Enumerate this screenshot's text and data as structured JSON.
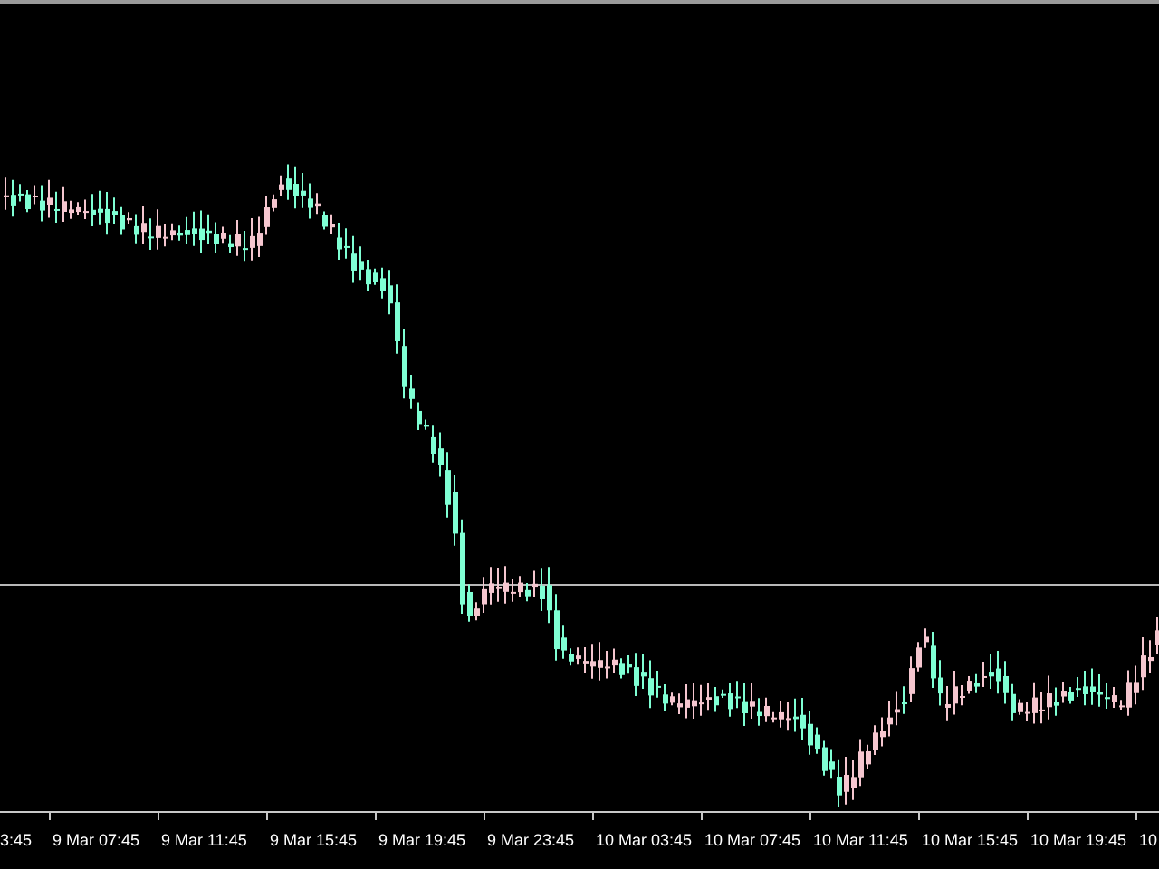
{
  "time_axis": {
    "labels": [
      "3:45",
      "9 Mar 07:45",
      "9 Mar 11:45",
      "9 Mar 15:45",
      "9 Mar 19:45",
      "9 Mar 23:45",
      "10 Mar 03:45",
      "10 Mar 07:45",
      "10 Mar 11:45",
      "10 Mar 15:45",
      "10 Mar 19:45",
      "10"
    ]
  }
}
